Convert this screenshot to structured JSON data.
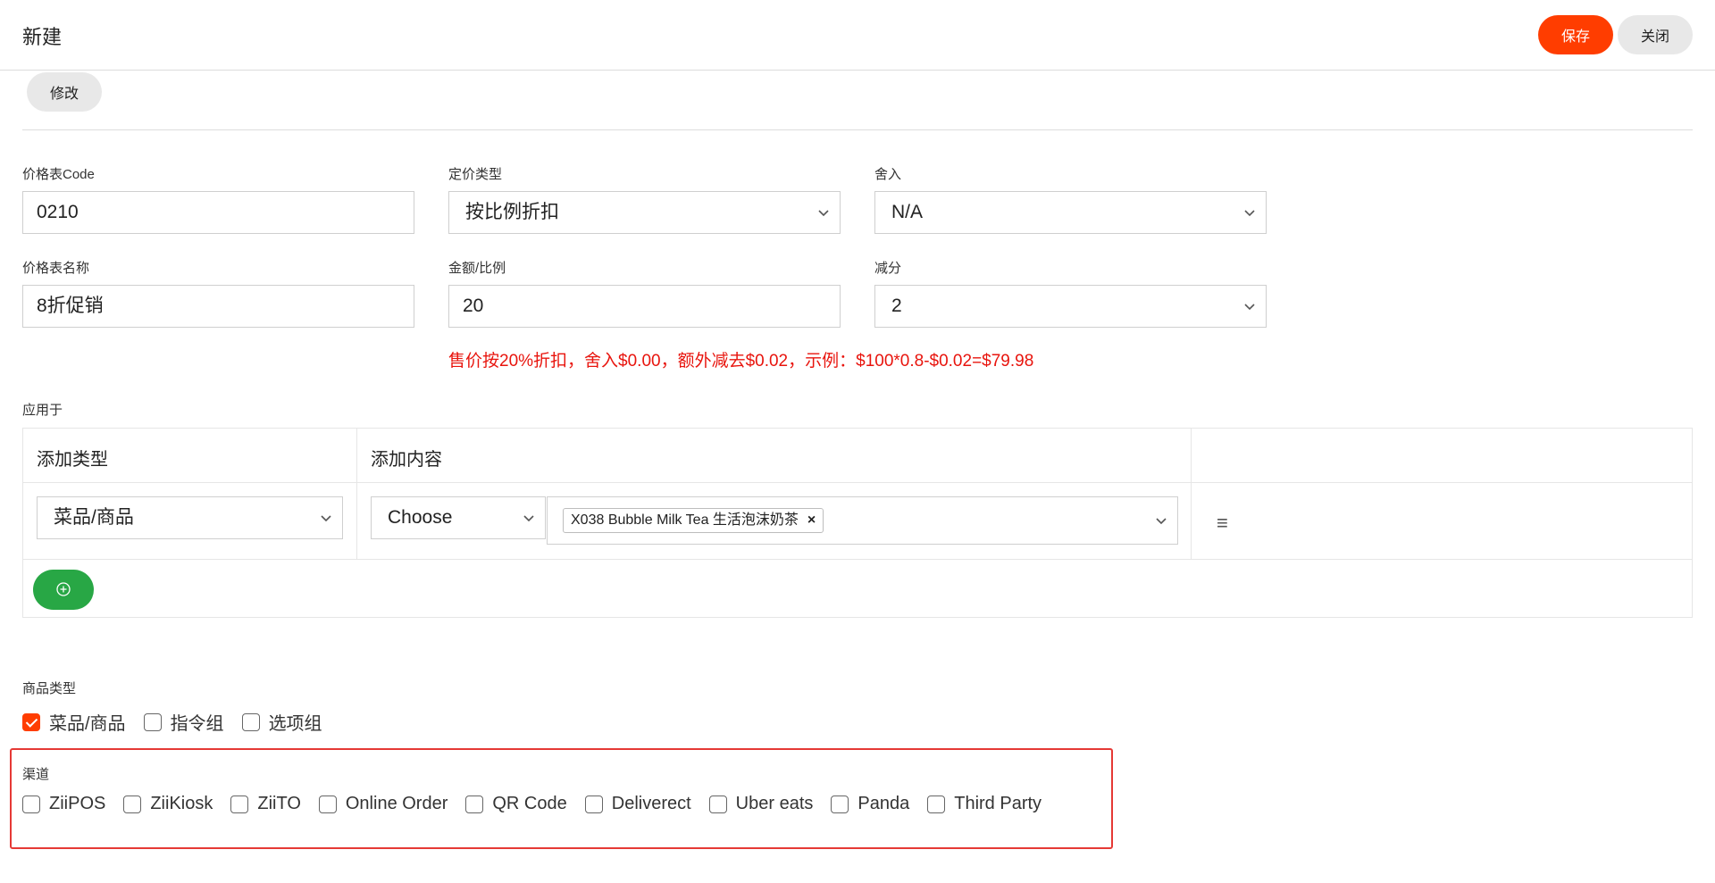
{
  "header": {
    "title": "新建",
    "save_label": "保存",
    "close_label": "关闭"
  },
  "toolbar": {
    "modify_label": "修改"
  },
  "form": {
    "code": {
      "label": "价格表Code",
      "value": "0210"
    },
    "pricing_type": {
      "label": "定价类型",
      "value": "按比例折扣"
    },
    "rounding": {
      "label": "舍入",
      "value": "N/A"
    },
    "name": {
      "label": "价格表名称",
      "value": "8折促销"
    },
    "amount_ratio": {
      "label": "金额/比例",
      "value": "20"
    },
    "deduction": {
      "label": "减分",
      "value": "2"
    },
    "hint": "售价按20%折扣，舍入$0.00，额外减去$0.02，示例：$100*0.8-$0.02=$79.98"
  },
  "apply_to": {
    "label": "应用于",
    "headers": [
      "添加类型",
      "添加内容",
      ""
    ],
    "rows": [
      {
        "type": "菜品/商品",
        "choose": "Choose",
        "tags": [
          "X038 Bubble Milk Tea 生活泡沫奶茶"
        ]
      }
    ],
    "tag_remove": "×",
    "menu_icon": "≡"
  },
  "product_type": {
    "label": "商品类型",
    "options": [
      {
        "label": "菜品/商品",
        "checked": true
      },
      {
        "label": "指令组",
        "checked": false
      },
      {
        "label": "选项组",
        "checked": false
      }
    ]
  },
  "channel": {
    "label": "渠道",
    "options": [
      {
        "label": "ZiiPOS",
        "checked": false
      },
      {
        "label": "ZiiKiosk",
        "checked": false
      },
      {
        "label": "ZiiTO",
        "checked": false
      },
      {
        "label": "Online Order",
        "checked": false
      },
      {
        "label": "QR Code",
        "checked": false
      },
      {
        "label": "Deliverect",
        "checked": false
      },
      {
        "label": "Uber eats",
        "checked": false
      },
      {
        "label": "Panda",
        "checked": false
      },
      {
        "label": "Third Party",
        "checked": false
      }
    ]
  },
  "colors": {
    "accent": "#ff3d00",
    "add_button": "#28a745",
    "hint_text": "#e8140d",
    "highlight_border": "#e53935"
  }
}
